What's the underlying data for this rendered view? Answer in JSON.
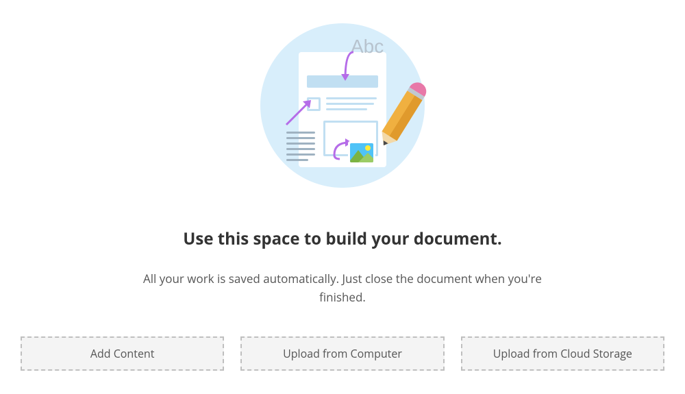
{
  "illustration": {
    "abc_text": "Abc"
  },
  "heading": "Use this space to build your document.",
  "subtext": "All your work is saved automatically. Just close the document when you're finished.",
  "buttons": {
    "add_content": "Add Content",
    "upload_computer": "Upload from Computer",
    "upload_cloud": "Upload from Cloud Storage"
  }
}
